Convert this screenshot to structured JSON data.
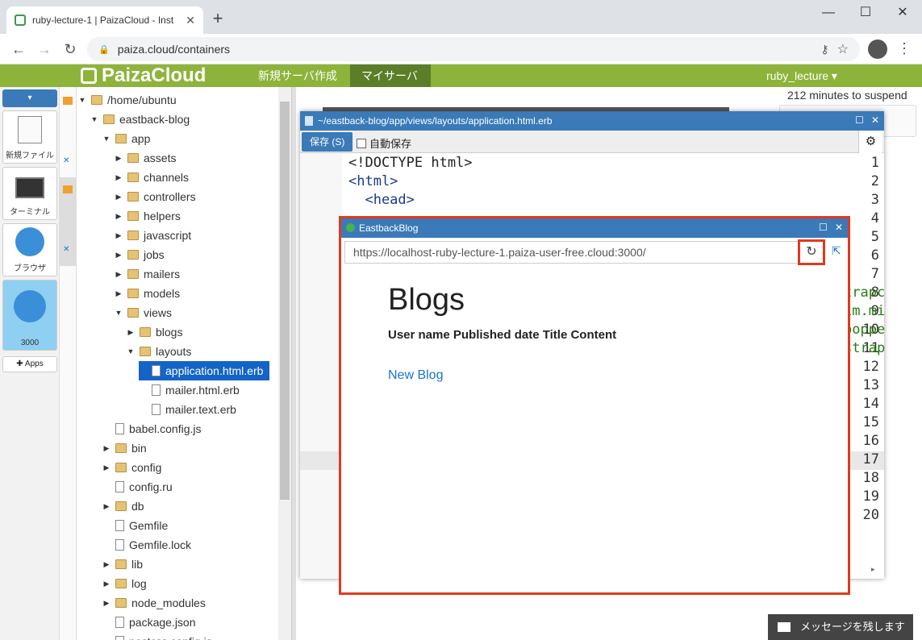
{
  "browser": {
    "tab_title": "ruby-lecture-1 | PaizaCloud - Inst",
    "url": "paiza.cloud/containers"
  },
  "header": {
    "logo": "PaizaCloud",
    "new_server": "新規サーバ作成",
    "my_server": "マイサーバ",
    "user": "ruby_lecture"
  },
  "dock": {
    "new_file": "新規ファイル",
    "terminal": "ターミナル",
    "browser": "ブラウザ",
    "port": "3000",
    "apps": "Apps"
  },
  "suspend": "212 minutes to suspend",
  "tree": [
    {
      "label": "/home/ubuntu",
      "type": "folder",
      "depth": 0,
      "open": true
    },
    {
      "label": "eastback-blog",
      "type": "folder",
      "depth": 1,
      "open": true
    },
    {
      "label": "app",
      "type": "folder",
      "depth": 2,
      "open": true
    },
    {
      "label": "assets",
      "type": "folder",
      "depth": 3,
      "open": false
    },
    {
      "label": "channels",
      "type": "folder",
      "depth": 3,
      "open": false
    },
    {
      "label": "controllers",
      "type": "folder",
      "depth": 3,
      "open": false
    },
    {
      "label": "helpers",
      "type": "folder",
      "depth": 3,
      "open": false
    },
    {
      "label": "javascript",
      "type": "folder",
      "depth": 3,
      "open": false
    },
    {
      "label": "jobs",
      "type": "folder",
      "depth": 3,
      "open": false
    },
    {
      "label": "mailers",
      "type": "folder",
      "depth": 3,
      "open": false
    },
    {
      "label": "models",
      "type": "folder",
      "depth": 3,
      "open": false
    },
    {
      "label": "views",
      "type": "folder",
      "depth": 3,
      "open": true
    },
    {
      "label": "blogs",
      "type": "folder",
      "depth": 4,
      "open": false
    },
    {
      "label": "layouts",
      "type": "folder",
      "depth": 4,
      "open": true
    },
    {
      "label": "application.html.erb",
      "type": "file",
      "depth": 5,
      "selected": true
    },
    {
      "label": "mailer.html.erb",
      "type": "file",
      "depth": 5
    },
    {
      "label": "mailer.text.erb",
      "type": "file",
      "depth": 5
    },
    {
      "label": "babel.config.js",
      "type": "file",
      "depth": 2
    },
    {
      "label": "bin",
      "type": "folder",
      "depth": 2,
      "open": false
    },
    {
      "label": "config",
      "type": "folder",
      "depth": 2,
      "open": false
    },
    {
      "label": "config.ru",
      "type": "file",
      "depth": 2
    },
    {
      "label": "db",
      "type": "folder",
      "depth": 2,
      "open": false
    },
    {
      "label": "Gemfile",
      "type": "file",
      "depth": 2
    },
    {
      "label": "Gemfile.lock",
      "type": "file",
      "depth": 2
    },
    {
      "label": "lib",
      "type": "folder",
      "depth": 2,
      "open": false
    },
    {
      "label": "log",
      "type": "folder",
      "depth": 2,
      "open": false
    },
    {
      "label": "node_modules",
      "type": "folder",
      "depth": 2,
      "open": false
    },
    {
      "label": "package.json",
      "type": "file",
      "depth": 2
    },
    {
      "label": "postcss.config.js",
      "type": "file",
      "depth": 2
    }
  ],
  "editor": {
    "title": "~/eastback-blog/app/views/layouts/application.html.erb",
    "save": "保存 (S)",
    "autosave": "自動保存",
    "lines": [
      "<!DOCTYPE html>",
      "<html>",
      "  <head>"
    ],
    "line_count": 20,
    "right_frags": [
      "trapc",
      "im.mi",
      "poppe",
      "strap"
    ]
  },
  "popup": {
    "title": "EastbackBlog",
    "url": "https://localhost-ruby-lecture-1.paiza-user-free.cloud:3000/",
    "heading": "Blogs",
    "columns": "User name Published date Title Content",
    "link": "New Blog"
  },
  "message": "メッセージを残します"
}
